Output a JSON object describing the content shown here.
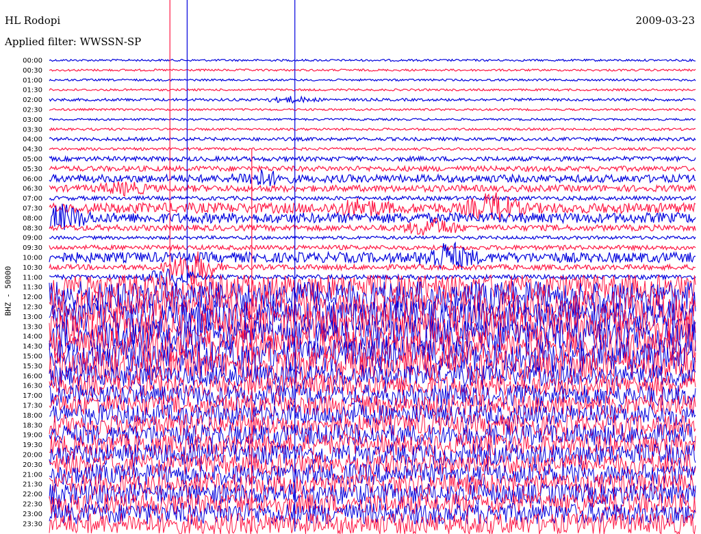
{
  "header": {
    "station": "HL Rodopi",
    "date": "2009-03-23",
    "filter": "Applied filter: WWSSN-SP",
    "channel_label": "BHZ - 50000"
  },
  "chart_data": {
    "type": "line",
    "chart_kind": "helicorder",
    "row_labels": [
      "00:00",
      "00:30",
      "01:00",
      "01:30",
      "02:00",
      "02:30",
      "03:00",
      "03:30",
      "04:00",
      "04:30",
      "05:00",
      "05:30",
      "06:00",
      "06:30",
      "07:00",
      "07:30",
      "08:00",
      "08:30",
      "09:00",
      "09:30",
      "10:00",
      "10:30",
      "11:00",
      "11:30",
      "12:00",
      "12:30",
      "13:00",
      "13:30",
      "14:00",
      "14:30",
      "15:00",
      "15:30",
      "16:00",
      "16:30",
      "17:00",
      "17:30",
      "18:00",
      "18:30",
      "19:00",
      "19:30",
      "20:00",
      "20:30",
      "21:00",
      "21:30",
      "22:00",
      "22:30",
      "23:00",
      "23:30"
    ],
    "colors": {
      "even_rows": "#0000dd",
      "odd_rows": "#ff1744"
    },
    "activity": [
      0.04,
      0.04,
      0.04,
      0.04,
      0.06,
      0.04,
      0.04,
      0.05,
      0.08,
      0.06,
      0.12,
      0.14,
      0.22,
      0.18,
      0.1,
      0.3,
      0.3,
      0.16,
      0.08,
      0.12,
      0.3,
      0.14,
      0.12,
      0.75,
      1.0,
      1.0,
      1.0,
      1.0,
      1.0,
      1.0,
      1.0,
      0.9,
      0.65,
      0.65,
      0.65,
      0.65,
      0.65,
      0.65,
      0.65,
      0.65,
      0.65,
      0.65,
      0.65,
      0.65,
      0.65,
      0.65,
      0.65,
      0.65
    ],
    "events": [
      {
        "row_label": "02:00",
        "minute": 11.2,
        "amp": 0.18
      },
      {
        "row_label": "06:00",
        "minute": 9.8,
        "amp": 0.45
      },
      {
        "row_label": "06:30",
        "minute": 3.5,
        "amp": 0.35
      },
      {
        "row_label": "07:30",
        "minute": 14.5,
        "amp": 0.5
      },
      {
        "row_label": "07:30",
        "minute": 20.6,
        "amp": 0.9
      },
      {
        "row_label": "08:00",
        "minute": 0.6,
        "amp": 0.7
      },
      {
        "row_label": "08:30",
        "minute": 17.8,
        "amp": 0.6
      },
      {
        "row_label": "10:00",
        "minute": 18.5,
        "amp": 0.9
      },
      {
        "row_label": "10:30",
        "minute": 6.6,
        "amp": 1.2
      },
      {
        "row_label": "11:00",
        "minute": 5.6,
        "amp": 0.6
      }
    ],
    "spikes": [
      {
        "minute": 5.6,
        "from_row": "00:00",
        "to_row": "11:00"
      },
      {
        "minute": 6.4,
        "from_row": "00:00",
        "to_row": "11:00"
      },
      {
        "minute": 9.4,
        "from_row": "05:00",
        "to_row": "23:30"
      },
      {
        "minute": 11.4,
        "from_row": "00:00",
        "to_row": "23:30"
      }
    ]
  }
}
